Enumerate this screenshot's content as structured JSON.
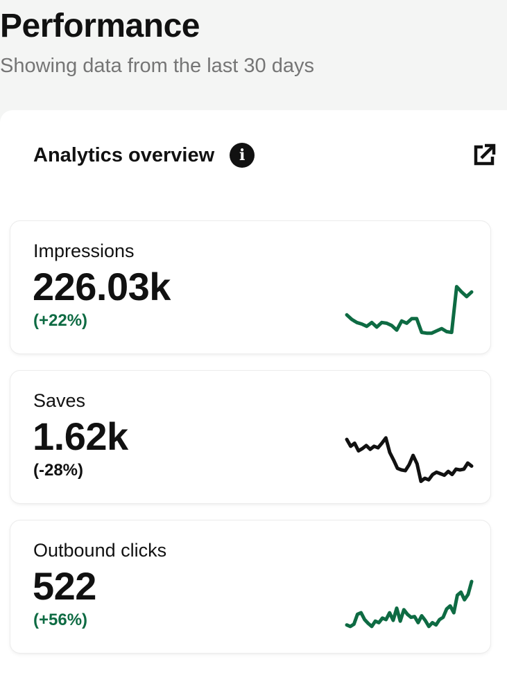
{
  "header": {
    "title": "Performance",
    "subtitle": "Showing data from the last 30 days"
  },
  "panel": {
    "title": "Analytics overview",
    "info_icon": "info-icon",
    "external_icon": "external-link-icon"
  },
  "colors": {
    "positive": "#0e6b43",
    "negative": "#111111"
  },
  "metrics": [
    {
      "label": "Impressions",
      "value": "226.03k",
      "change": "(+22%)",
      "trend": "positive",
      "sparkline": [
        73,
        79,
        83,
        85,
        88,
        83,
        89,
        83,
        84,
        87,
        93,
        81,
        84,
        78,
        78,
        96,
        97,
        97,
        94,
        91,
        95,
        96,
        36,
        43,
        49,
        43
      ]
    },
    {
      "label": "Saves",
      "value": "1.62k",
      "change": "(-28%)",
      "trend": "negative",
      "sparkline": [
        40,
        49,
        45,
        55,
        52,
        48,
        53,
        49,
        51,
        45,
        38,
        57,
        67,
        78,
        80,
        81,
        73,
        61,
        72,
        95,
        91,
        93,
        86,
        83,
        85,
        87,
        82,
        86,
        79,
        80,
        79,
        71,
        75
      ]
    },
    {
      "label": "Outbound clicks",
      "value": "522",
      "change": "(+56%)",
      "trend": "positive",
      "sparkline": [
        87,
        89,
        86,
        73,
        71,
        80,
        85,
        89,
        82,
        84,
        78,
        80,
        71,
        81,
        65,
        82,
        67,
        73,
        77,
        76,
        84,
        75,
        81,
        89,
        84,
        87,
        80,
        77,
        66,
        62,
        71,
        48,
        44,
        54,
        47,
        30
      ]
    }
  ]
}
